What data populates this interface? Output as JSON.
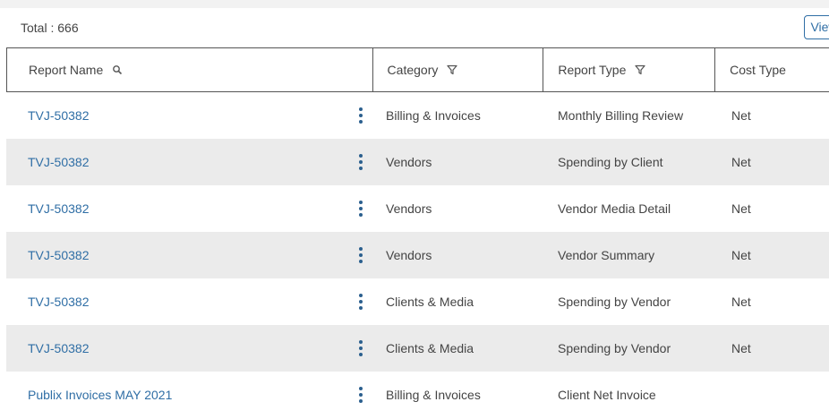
{
  "toolbar": {
    "total_label": "Total : 666",
    "view_button_label": "View"
  },
  "table": {
    "columns": [
      {
        "label": "Report Name",
        "icon": "search-icon"
      },
      {
        "label": "Category",
        "icon": "filter-icon"
      },
      {
        "label": "Report Type",
        "icon": "filter-icon"
      },
      {
        "label": "Cost Type",
        "icon": ""
      }
    ],
    "rows": [
      {
        "name": "TVJ-50382",
        "category": "Billing & Invoices",
        "type": "Monthly Billing Review",
        "cost": "Net"
      },
      {
        "name": "TVJ-50382",
        "category": "Vendors",
        "type": "Spending by Client",
        "cost": "Net"
      },
      {
        "name": "TVJ-50382",
        "category": "Vendors",
        "type": "Vendor Media Detail",
        "cost": "Net"
      },
      {
        "name": "TVJ-50382",
        "category": "Vendors",
        "type": "Vendor Summary",
        "cost": "Net"
      },
      {
        "name": "TVJ-50382",
        "category": "Clients & Media",
        "type": "Spending by Vendor",
        "cost": "Net"
      },
      {
        "name": "TVJ-50382",
        "category": "Clients & Media",
        "type": "Spending by Vendor",
        "cost": "Net"
      },
      {
        "name": "Publix Invoices MAY 2021",
        "category": "Billing & Invoices",
        "type": "Client Net Invoice",
        "cost": ""
      }
    ]
  },
  "colors": {
    "link": "#2f6ea5",
    "row_alt": "#ebebeb",
    "kebab": "#2b5f8e"
  }
}
